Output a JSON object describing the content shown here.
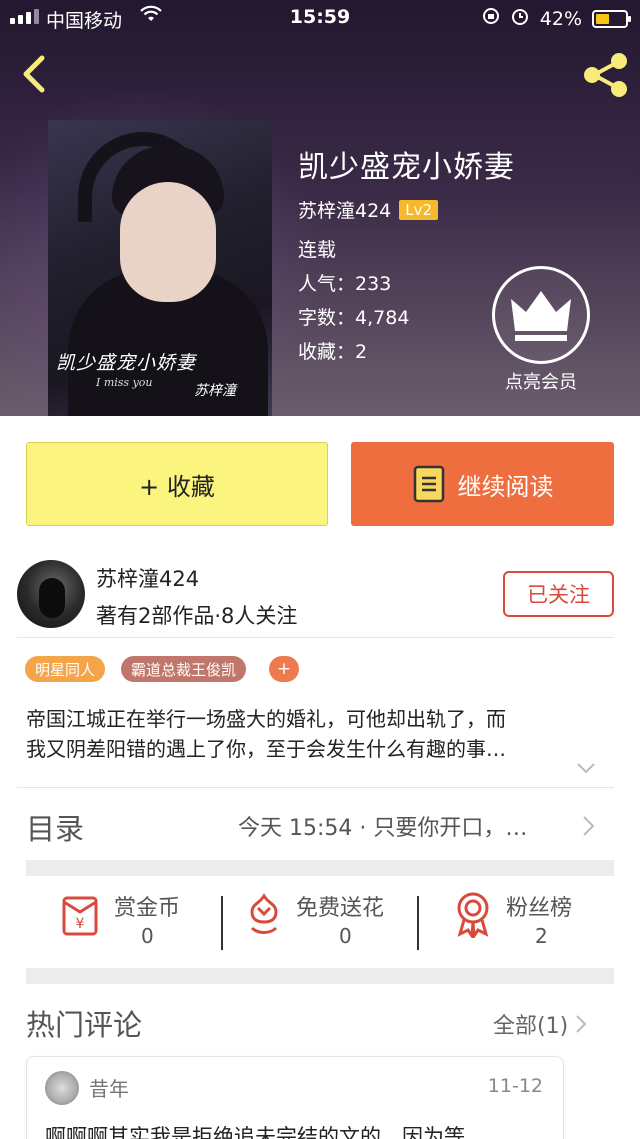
{
  "status_bar": {
    "carrier": "中国移动",
    "time": "15:59",
    "battery": "42%"
  },
  "book": {
    "title": "凯少盛宠小娇妻",
    "author": "苏梓潼424",
    "level": "Lv2",
    "status": "连载",
    "popularity_label": "人气：",
    "popularity": "233",
    "word_count_label": "字数：",
    "word_count": "4,784",
    "favorites_label": "收藏：",
    "favorites": "2",
    "cover": {
      "title_text": "凯少盛宠小娇妻",
      "subtitle_text": "I miss you",
      "author_text": "苏梓潼"
    }
  },
  "vip": {
    "label": "点亮会员"
  },
  "actions": {
    "favorite_label": "+ 收藏",
    "read_label": "继续阅读"
  },
  "author_info": {
    "name": "苏梓潼424",
    "stats": "著有2部作品·8人关注",
    "follow_label": "已关注"
  },
  "tags": [
    "明星同人",
    "霸道总裁王俊凯",
    "+"
  ],
  "synopsis": {
    "line1": "帝国江城正在举行一场盛大的婚礼，可他却出轨了，而",
    "line2": "我又阴差阳错的遇上了你，至于会发生什么有趣的事…"
  },
  "toc": {
    "label": "目录",
    "latest": "今天 15:54 · 只要你开口，…"
  },
  "stats": [
    {
      "label": "赏金币",
      "value": "0"
    },
    {
      "label": "免费送花",
      "value": "0"
    },
    {
      "label": "粉丝榜",
      "value": "2"
    }
  ],
  "comments": {
    "title": "热门评论",
    "all_label": "全部(1)",
    "items": [
      {
        "user": "昔年",
        "date": "11-12",
        "text": "啊啊啊其实我是拒绝追未完结的文的，因为等"
      }
    ]
  },
  "colors": {
    "favorite_button": "#fbf57f",
    "read_button": "#ee6e3f",
    "follow_border": "#d84a3c",
    "level_badge": "#f7b92c",
    "stat_icon": "#d84a3c"
  }
}
